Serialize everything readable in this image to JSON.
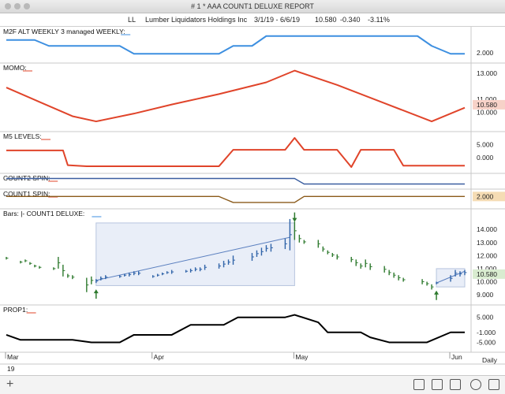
{
  "window": {
    "title": "# 1 *  AAA COUNT1 DELUXE REPORT"
  },
  "header": {
    "symbol": "LL",
    "company": "Lumber Liquidators Holdings Inc",
    "date_range": "3/1/19 - 6/6/19",
    "last": "10.580",
    "change": "-0.340",
    "change_pct": "-3.11%"
  },
  "footer": {
    "add": "+",
    "interval": "Daily"
  },
  "colors": {
    "blue": "#3d8fe0",
    "red": "#e0442a",
    "navy": "#3a5ea0",
    "brown": "#8a5a1a",
    "green": "#2e7a2e",
    "bluebar": "#2f63a8",
    "black": "#000000"
  },
  "chart_data": [
    {
      "id": "m2f",
      "type": "line",
      "title": "M2F ALT WEEKLY 3 managed WEEKLY:",
      "yticks": [
        "2.000"
      ],
      "ytick_values": [
        2
      ],
      "ylim": [
        1.6,
        3.2
      ],
      "series": [
        {
          "values": [
            {
              "x": "2019-03-01",
              "y": 2.65
            },
            {
              "x": "2019-03-07",
              "y": 2.65
            },
            {
              "x": "2019-03-10",
              "y": 2.35
            },
            {
              "x": "2019-03-25",
              "y": 2.35
            },
            {
              "x": "2019-03-28",
              "y": 1.95
            },
            {
              "x": "2019-04-15",
              "y": 1.95
            },
            {
              "x": "2019-04-18",
              "y": 2.35
            },
            {
              "x": "2019-04-22",
              "y": 2.35
            },
            {
              "x": "2019-04-25",
              "y": 2.85
            },
            {
              "x": "2019-05-27",
              "y": 2.85
            },
            {
              "x": "2019-05-30",
              "y": 2.35
            },
            {
              "x": "2019-06-03",
              "y": 1.95
            },
            {
              "x": "2019-06-06",
              "y": 1.95
            }
          ]
        }
      ]
    },
    {
      "id": "momo",
      "type": "line",
      "title": "MOMO:",
      "yticks": [
        "13.000",
        "11.000",
        "10.000"
      ],
      "ytick_values": [
        13,
        11,
        10
      ],
      "last_value": "10.580",
      "ylim": [
        8.7,
        13.6
      ],
      "series": [
        {
          "values": [
            {
              "x": "2019-03-01",
              "y": 11.9
            },
            {
              "x": "2019-03-08",
              "y": 10.8
            },
            {
              "x": "2019-03-15",
              "y": 9.7
            },
            {
              "x": "2019-03-20",
              "y": 9.3
            },
            {
              "x": "2019-03-28",
              "y": 9.9
            },
            {
              "x": "2019-04-05",
              "y": 10.6
            },
            {
              "x": "2019-04-15",
              "y": 11.4
            },
            {
              "x": "2019-04-25",
              "y": 12.3
            },
            {
              "x": "2019-05-01",
              "y": 13.2
            },
            {
              "x": "2019-05-10",
              "y": 12.1
            },
            {
              "x": "2019-05-20",
              "y": 10.7
            },
            {
              "x": "2019-05-30",
              "y": 9.3
            },
            {
              "x": "2019-06-06",
              "y": 10.35
            }
          ]
        }
      ]
    },
    {
      "id": "m5",
      "type": "line",
      "title": "M5 LEVELS:",
      "yticks": [
        "5.000",
        "0.000"
      ],
      "ytick_values": [
        5,
        0
      ],
      "ylim": [
        -5,
        9
      ],
      "series": [
        {
          "values": [
            {
              "x": "2019-03-01",
              "y": 2.8
            },
            {
              "x": "2019-03-13",
              "y": 2.8
            },
            {
              "x": "2019-03-14",
              "y": -2.8
            },
            {
              "x": "2019-03-18",
              "y": -3.2
            },
            {
              "x": "2019-04-15",
              "y": -3.2
            },
            {
              "x": "2019-04-18",
              "y": 3
            },
            {
              "x": "2019-04-29",
              "y": 3
            },
            {
              "x": "2019-05-01",
              "y": 7.5
            },
            {
              "x": "2019-05-03",
              "y": 3
            },
            {
              "x": "2019-05-10",
              "y": 3
            },
            {
              "x": "2019-05-13",
              "y": -3.5
            },
            {
              "x": "2019-05-15",
              "y": 3
            },
            {
              "x": "2019-05-22",
              "y": 3
            },
            {
              "x": "2019-05-24",
              "y": -3
            },
            {
              "x": "2019-06-04",
              "y": -3
            },
            {
              "x": "2019-06-06",
              "y": -3
            }
          ]
        }
      ]
    },
    {
      "id": "count2",
      "type": "line",
      "title": "COUNT2 SPIN:",
      "yticks": [],
      "ylim": [
        0,
        1
      ],
      "series": [
        {
          "values": [
            {
              "x": "2019-03-01",
              "y": 0.75
            },
            {
              "x": "2019-05-01",
              "y": 0.75
            },
            {
              "x": "2019-05-03",
              "y": 0.25
            },
            {
              "x": "2019-06-06",
              "y": 0.25
            }
          ]
        }
      ]
    },
    {
      "id": "count1",
      "type": "line",
      "title": "COUNT1 SPIN:",
      "yticks": [
        "2.000"
      ],
      "ytick_values": [
        2
      ],
      "ylim": [
        0,
        3
      ],
      "series": [
        {
          "values": [
            {
              "x": "2019-03-01",
              "y": 2
            },
            {
              "x": "2019-04-15",
              "y": 2
            },
            {
              "x": "2019-04-18",
              "y": 0.8
            },
            {
              "x": "2019-05-01",
              "y": 0.8
            },
            {
              "x": "2019-05-03",
              "y": 2
            },
            {
              "x": "2019-06-06",
              "y": 2
            }
          ]
        }
      ]
    },
    {
      "id": "bars",
      "type": "ohlc",
      "title": "Bars: |-  COUNT1 DELUXE:",
      "yticks": [
        "14.000",
        "13.000",
        "12.000",
        "11.000",
        "10.000",
        "9.000"
      ],
      "ytick_values": [
        14,
        13,
        12,
        11,
        10,
        9
      ],
      "last_value": "10.580",
      "ylim": [
        8.4,
        15.4
      ],
      "bars": [
        {
          "x": "2019-03-01",
          "h": 11.9,
          "l": 11.7,
          "c": "green"
        },
        {
          "x": "2019-03-04",
          "h": 11.6,
          "l": 11.4,
          "c": "green"
        },
        {
          "x": "2019-03-05",
          "h": 11.7,
          "l": 11.5,
          "c": "green"
        },
        {
          "x": "2019-03-06",
          "h": 11.5,
          "l": 11.3,
          "c": "green"
        },
        {
          "x": "2019-03-07",
          "h": 11.3,
          "l": 11.1,
          "c": "green"
        },
        {
          "x": "2019-03-08",
          "h": 11.2,
          "l": 11.0,
          "c": "green"
        },
        {
          "x": "2019-03-11",
          "h": 11.1,
          "l": 10.9,
          "c": "green"
        },
        {
          "x": "2019-03-12",
          "h": 11.9,
          "l": 11.0,
          "c": "green"
        },
        {
          "x": "2019-03-13",
          "h": 11.3,
          "l": 10.4,
          "c": "green"
        },
        {
          "x": "2019-03-14",
          "h": 10.6,
          "l": 10.3,
          "c": "green"
        },
        {
          "x": "2019-03-15",
          "h": 10.5,
          "l": 10.2,
          "c": "green"
        },
        {
          "x": "2019-03-18",
          "h": 10.3,
          "l": 9.2,
          "c": "green"
        },
        {
          "x": "2019-03-19",
          "h": 10.4,
          "l": 9.8,
          "c": "green"
        },
        {
          "x": "2019-03-20",
          "h": 10.2,
          "l": 9.9,
          "c": "blue"
        },
        {
          "x": "2019-03-21",
          "h": 10.4,
          "l": 10.1,
          "c": "blue"
        },
        {
          "x": "2019-03-22",
          "h": 10.5,
          "l": 10.2,
          "c": "blue"
        },
        {
          "x": "2019-03-25",
          "h": 10.5,
          "l": 10.3,
          "c": "blue"
        },
        {
          "x": "2019-03-26",
          "h": 10.6,
          "l": 10.4,
          "c": "blue"
        },
        {
          "x": "2019-03-27",
          "h": 10.7,
          "l": 10.4,
          "c": "blue"
        },
        {
          "x": "2019-03-28",
          "h": 10.8,
          "l": 10.5,
          "c": "blue"
        },
        {
          "x": "2019-03-29",
          "h": 10.8,
          "l": 10.5,
          "c": "blue"
        },
        {
          "x": "2019-04-01",
          "h": 10.5,
          "l": 10.3,
          "c": "blue"
        },
        {
          "x": "2019-04-02",
          "h": 10.6,
          "l": 10.4,
          "c": "blue"
        },
        {
          "x": "2019-04-03",
          "h": 10.7,
          "l": 10.5,
          "c": "blue"
        },
        {
          "x": "2019-04-04",
          "h": 10.8,
          "l": 10.6,
          "c": "blue"
        },
        {
          "x": "2019-04-05",
          "h": 10.9,
          "l": 10.6,
          "c": "blue"
        },
        {
          "x": "2019-04-08",
          "h": 10.9,
          "l": 10.7,
          "c": "blue"
        },
        {
          "x": "2019-04-09",
          "h": 11.0,
          "l": 10.7,
          "c": "blue"
        },
        {
          "x": "2019-04-10",
          "h": 11.1,
          "l": 10.8,
          "c": "blue"
        },
        {
          "x": "2019-04-11",
          "h": 11.1,
          "l": 10.8,
          "c": "blue"
        },
        {
          "x": "2019-04-12",
          "h": 11.3,
          "l": 10.9,
          "c": "blue"
        },
        {
          "x": "2019-04-15",
          "h": 11.4,
          "l": 11.0,
          "c": "blue"
        },
        {
          "x": "2019-04-16",
          "h": 11.6,
          "l": 11.1,
          "c": "blue"
        },
        {
          "x": "2019-04-17",
          "h": 11.7,
          "l": 11.3,
          "c": "blue"
        },
        {
          "x": "2019-04-18",
          "h": 12.0,
          "l": 11.3,
          "c": "blue"
        },
        {
          "x": "2019-04-22",
          "h": 12.2,
          "l": 11.6,
          "c": "blue"
        },
        {
          "x": "2019-04-23",
          "h": 12.4,
          "l": 11.9,
          "c": "blue"
        },
        {
          "x": "2019-04-24",
          "h": 12.6,
          "l": 12.0,
          "c": "blue"
        },
        {
          "x": "2019-04-25",
          "h": 12.8,
          "l": 12.3,
          "c": "blue"
        },
        {
          "x": "2019-04-26",
          "h": 12.9,
          "l": 12.3,
          "c": "blue"
        },
        {
          "x": "2019-04-29",
          "h": 13.3,
          "l": 12.5,
          "c": "blue"
        },
        {
          "x": "2019-04-30",
          "h": 14.8,
          "l": 12.4,
          "c": "blue"
        },
        {
          "x": "2019-05-01",
          "h": 14.6,
          "l": 13.2,
          "c": "green"
        },
        {
          "x": "2019-05-02",
          "h": 13.6,
          "l": 13.0,
          "c": "green"
        },
        {
          "x": "2019-05-03",
          "h": 13.2,
          "l": 12.9,
          "c": "green"
        },
        {
          "x": "2019-05-06",
          "h": 13.2,
          "l": 12.6,
          "c": "green"
        },
        {
          "x": "2019-05-07",
          "h": 12.7,
          "l": 12.3,
          "c": "green"
        },
        {
          "x": "2019-05-08",
          "h": 12.4,
          "l": 12.1,
          "c": "green"
        },
        {
          "x": "2019-05-09",
          "h": 12.2,
          "l": 11.9,
          "c": "green"
        },
        {
          "x": "2019-05-10",
          "h": 12.1,
          "l": 11.7,
          "c": "green"
        },
        {
          "x": "2019-05-13",
          "h": 11.9,
          "l": 11.5,
          "c": "green"
        },
        {
          "x": "2019-05-14",
          "h": 11.7,
          "l": 11.2,
          "c": "green"
        },
        {
          "x": "2019-05-15",
          "h": 11.4,
          "l": 11.0,
          "c": "green"
        },
        {
          "x": "2019-05-16",
          "h": 11.7,
          "l": 11.1,
          "c": "green"
        },
        {
          "x": "2019-05-17",
          "h": 11.4,
          "l": 10.9,
          "c": "green"
        },
        {
          "x": "2019-05-20",
          "h": 11.2,
          "l": 10.7,
          "c": "green"
        },
        {
          "x": "2019-05-21",
          "h": 10.9,
          "l": 10.5,
          "c": "green"
        },
        {
          "x": "2019-05-22",
          "h": 10.7,
          "l": 10.3,
          "c": "green"
        },
        {
          "x": "2019-05-23",
          "h": 10.5,
          "l": 10.1,
          "c": "green"
        },
        {
          "x": "2019-05-24",
          "h": 10.3,
          "l": 10.0,
          "c": "green"
        },
        {
          "x": "2019-05-28",
          "h": 10.2,
          "l": 9.8,
          "c": "green"
        },
        {
          "x": "2019-05-29",
          "h": 10.0,
          "l": 9.7,
          "c": "green"
        },
        {
          "x": "2019-05-30",
          "h": 9.8,
          "l": 9.4,
          "c": "green"
        },
        {
          "x": "2019-05-31",
          "h": 10.0,
          "l": 9.8,
          "c": "blue"
        },
        {
          "x": "2019-06-03",
          "h": 10.5,
          "l": 10.0,
          "c": "blue"
        },
        {
          "x": "2019-06-04",
          "h": 10.9,
          "l": 10.4,
          "c": "blue"
        },
        {
          "x": "2019-06-05",
          "h": 10.8,
          "l": 10.4,
          "c": "blue"
        },
        {
          "x": "2019-06-06",
          "h": 10.9,
          "l": 10.5,
          "c": "blue"
        }
      ],
      "trendlines": [
        {
          "from": {
            "x": "2019-03-20",
            "y": 10.1
          },
          "to": {
            "x": "2019-04-30",
            "y": 13.4
          }
        },
        {
          "from": {
            "x": "2019-05-31",
            "y": 9.9
          },
          "to": {
            "x": "2019-06-06",
            "y": 10.8
          }
        }
      ],
      "boxes": [
        {
          "x0": "2019-03-20",
          "x1": "2019-05-01",
          "y0": 9.7,
          "y1": 14.5
        },
        {
          "x0": "2019-05-31",
          "x1": "2019-06-06",
          "y0": 9.6,
          "y1": 11.0
        }
      ],
      "arrows": [
        {
          "x": "2019-03-20",
          "y": 9.3,
          "dir": "up"
        },
        {
          "x": "2019-05-01",
          "y": 14.7,
          "dir": "down"
        },
        {
          "x": "2019-05-31",
          "y": 9.2,
          "dir": "up"
        }
      ]
    },
    {
      "id": "prop1",
      "type": "line",
      "title": "PROP1:",
      "yticks": [
        "5.000",
        "-1.000",
        "-5.000"
      ],
      "ytick_values": [
        5,
        -1,
        -5
      ],
      "ylim": [
        -8,
        9
      ],
      "series": [
        {
          "values": [
            {
              "x": "2019-03-01",
              "y": -2
            },
            {
              "x": "2019-03-04",
              "y": -4
            },
            {
              "x": "2019-03-15",
              "y": -4
            },
            {
              "x": "2019-03-19",
              "y": -5
            },
            {
              "x": "2019-03-25",
              "y": -5
            },
            {
              "x": "2019-03-28",
              "y": -2
            },
            {
              "x": "2019-04-05",
              "y": -2
            },
            {
              "x": "2019-04-09",
              "y": 2
            },
            {
              "x": "2019-04-16",
              "y": 2
            },
            {
              "x": "2019-04-19",
              "y": 5
            },
            {
              "x": "2019-04-29",
              "y": 5
            },
            {
              "x": "2019-05-01",
              "y": 6
            },
            {
              "x": "2019-05-06",
              "y": 3
            },
            {
              "x": "2019-05-08",
              "y": -1
            },
            {
              "x": "2019-05-15",
              "y": -1
            },
            {
              "x": "2019-05-17",
              "y": -3
            },
            {
              "x": "2019-05-21",
              "y": -5
            },
            {
              "x": "2019-05-29",
              "y": -5
            },
            {
              "x": "2019-06-03",
              "y": -1
            },
            {
              "x": "2019-06-06",
              "y": -1
            }
          ]
        }
      ]
    }
  ],
  "xaxis": {
    "range": [
      "2019-03-01",
      "2019-06-06"
    ],
    "labels": [
      {
        "x": "2019-03-01",
        "text": "Mar"
      },
      {
        "x": "2019-03-01",
        "text": "19",
        "sub": true
      },
      {
        "x": "2019-04-01",
        "text": "Apr"
      },
      {
        "x": "2019-05-01",
        "text": "May"
      },
      {
        "x": "2019-06-03",
        "text": "Jun"
      }
    ],
    "interval": "Daily"
  }
}
